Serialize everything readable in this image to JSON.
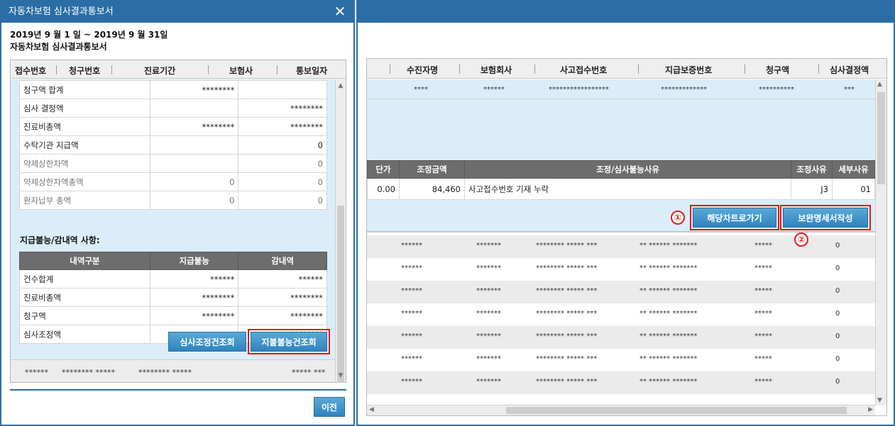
{
  "left_window": {
    "title": "자동차보험 심사결과통보서",
    "period": "2019년  9 월  1 일 ~ 2019년  9 월 31일",
    "subtitle": "자동차보험 심사결과통보서",
    "columns": [
      "접수번호",
      "청구번호",
      "진료기간",
      "보험사",
      "통보일자"
    ],
    "summary_rows": [
      {
        "label": "청구액 합계",
        "a": "********",
        "b": ""
      },
      {
        "label": "심사 결정액",
        "a": "",
        "b": "********"
      },
      {
        "label": "진료비총액",
        "a": "********",
        "b": "********"
      },
      {
        "label": "수탁기관 지급액",
        "a": "",
        "b": "0"
      },
      {
        "label": "약제상한차액",
        "a": "",
        "b": "0"
      },
      {
        "label": "약제상한차액총액",
        "a": "0",
        "b": "0"
      },
      {
        "label": "환자납부 총액",
        "a": "0",
        "b": "0"
      }
    ],
    "section_label": "지급불능/감내역 사항:",
    "deduct_headers": [
      "내역구분",
      "지급불능",
      "감내역"
    ],
    "deduct_rows": [
      {
        "label": "건수합계",
        "a": "******",
        "b": "******"
      },
      {
        "label": "진료비총액",
        "a": "********",
        "b": "********"
      },
      {
        "label": "청구액",
        "a": "********",
        "b": "********"
      },
      {
        "label": "심사조정액",
        "a": "",
        "b": "********"
      }
    ],
    "btn_review_adjust": "심사조정건조회",
    "btn_nonpayment": "지불불능건조회",
    "footer": [
      "******",
      "********  *****",
      "********  *****",
      "*****  ***"
    ],
    "btn_prev": "이전"
  },
  "right_window": {
    "columns": [
      "수진자명",
      "보험회사",
      "사고접수번호",
      "지급보증번호",
      "청구액",
      "심사결정액"
    ],
    "first_row": [
      "****",
      "******",
      "*****************",
      "*************",
      "**********",
      "***"
    ],
    "adj_headers": [
      "단가",
      "조정금액",
      "조정/심사불능사유",
      "조정사유",
      "세부사유"
    ],
    "adj_row": [
      "0.00",
      "84,460",
      "사고접수번호 기재 누락",
      "J3",
      "01"
    ],
    "btn_go_chart": "해당차트로가기",
    "btn_write_supplement": "보완명세서작성",
    "markers": [
      "①",
      "②"
    ],
    "data_rows": [
      [
        "******",
        "*******",
        "******** ***** ***",
        "**  ******  *******",
        "*****",
        "0"
      ],
      [
        "******",
        "*******",
        "******** ***** ***",
        "**  ******  *******",
        "*****",
        "0"
      ],
      [
        "******",
        "*******",
        "******** ***** ***",
        "**  ******  *******",
        "*****",
        "0"
      ],
      [
        "******",
        "*******",
        "******** ***** ***",
        "**  ******  *******",
        "*****",
        "0"
      ],
      [
        "******",
        "*******",
        "******** ***** ***",
        "**  ******  *******",
        "*****",
        "0"
      ],
      [
        "******",
        "*******",
        "******** ***** ***",
        "**  ******  *******",
        "*****",
        "0"
      ],
      [
        "******",
        "*******",
        "******** ***** ***",
        "**  ******  *******",
        "*****",
        "0"
      ]
    ]
  },
  "colors": {
    "titlebar": "#2b6ea6",
    "button": "#2f84bf",
    "highlight": "#e01b1b",
    "row_blue": "#dbedf8"
  }
}
